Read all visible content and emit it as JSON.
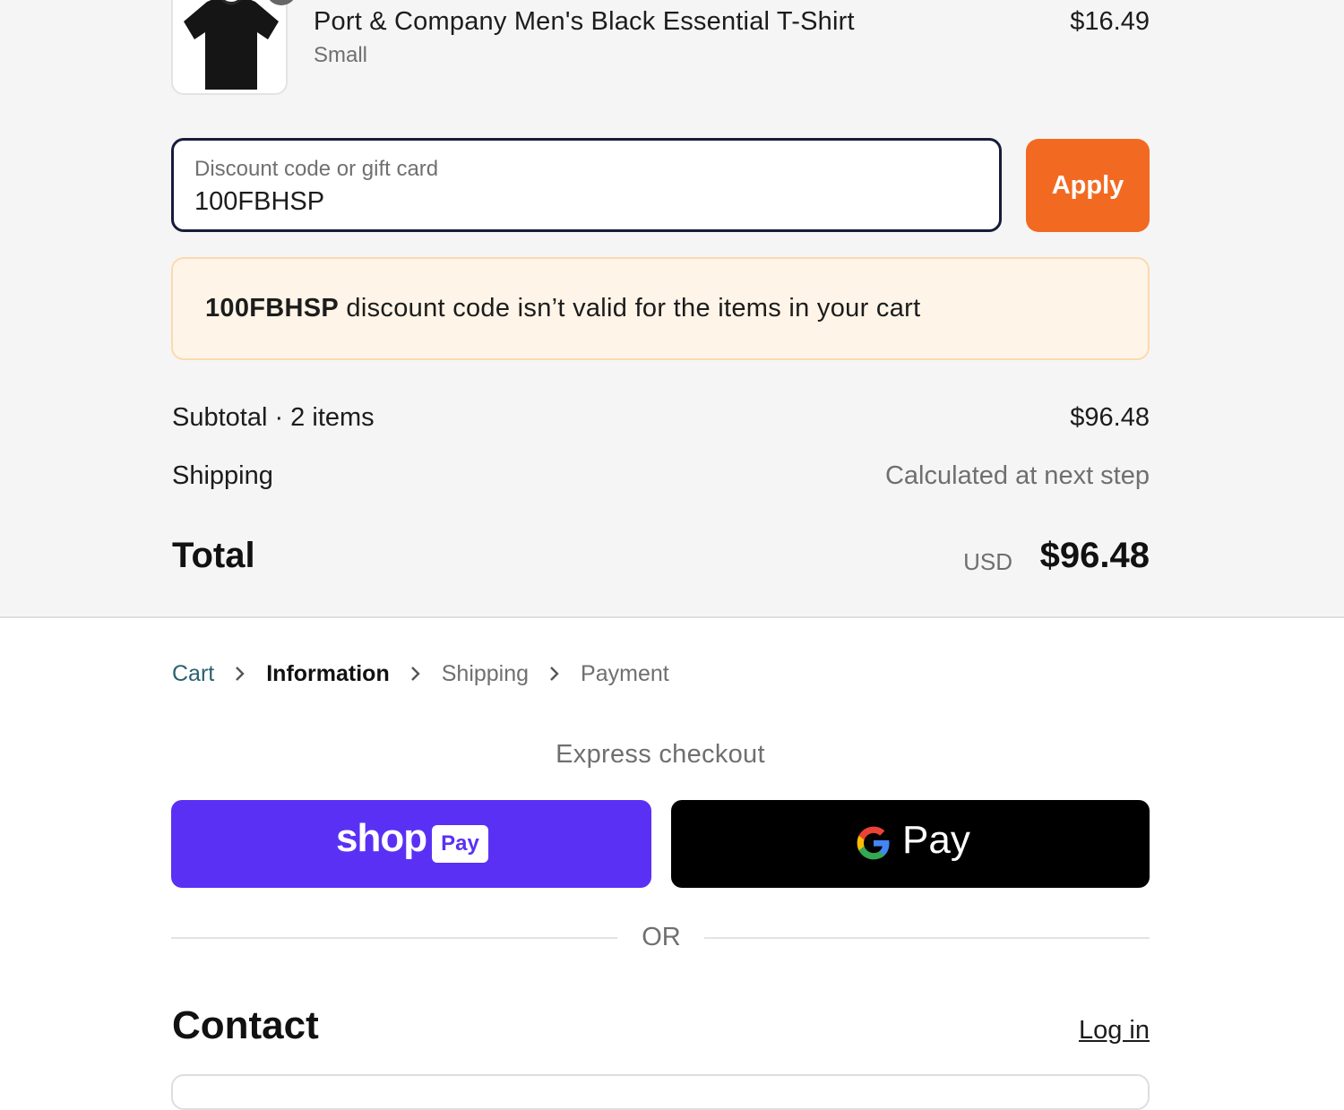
{
  "product": {
    "name": "Port & Company Men's Black Essential T-Shirt",
    "variant": "Small",
    "price": "$16.49",
    "image_icon": "black-t-shirt"
  },
  "discount": {
    "label": "Discount code or gift card",
    "value": "100FBHSP",
    "apply_label": "Apply"
  },
  "error": {
    "code": "100FBHSP",
    "message": " discount code isn’t valid for the items in your cart"
  },
  "totals": {
    "subtotal_label": "Subtotal · 2 items",
    "subtotal_value": "$96.48",
    "shipping_label": "Shipping",
    "shipping_value": "Calculated at next step",
    "total_label": "Total",
    "currency": "USD",
    "total_value": "$96.48"
  },
  "breadcrumb": {
    "cart": "Cart",
    "information": "Information",
    "shipping": "Shipping",
    "payment": "Payment"
  },
  "express": {
    "title": "Express checkout",
    "shop_word": "shop",
    "shop_pay_chip": "Pay",
    "gpay_word": "Pay"
  },
  "divider": {
    "or": "OR"
  },
  "contact": {
    "heading": "Contact",
    "login": "Log in"
  },
  "colors": {
    "accent_orange": "#f26a21",
    "shop_pay_purple": "#5a31f4",
    "error_bg": "#fff4e8",
    "field_focus_border": "#161c3a"
  }
}
